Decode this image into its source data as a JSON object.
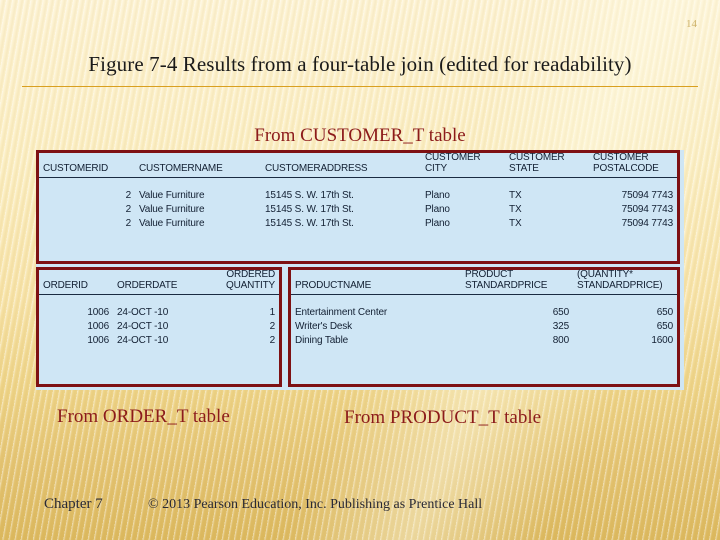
{
  "slide": {
    "title": "Figure 7-4 Results from a four-table join (edited for readability)",
    "accent_rule_color": "#d9a020",
    "caption_color": "#8c1b1b",
    "table_fill_color": "#cfe6f5",
    "table_border_color": "#7e1113",
    "background_top_color": "#fdf3d4",
    "background_bottom_color": "#dcb95f"
  },
  "captions": {
    "customer": "From CUSTOMER_T table",
    "order": "From ORDER_T table",
    "product": "From PRODUCT_T table"
  },
  "customer_table": {
    "headers": [
      {
        "line1": "",
        "line2": "CUSTOMERID"
      },
      {
        "line1": "",
        "line2": "CUSTOMERNAME"
      },
      {
        "line1": "",
        "line2": "CUSTOMERADDRESS"
      },
      {
        "line1": "CUSTOMER",
        "line2": "CITY"
      },
      {
        "line1": "CUSTOMER",
        "line2": "STATE"
      },
      {
        "line1": "CUSTOMER",
        "line2": "POSTALCODE"
      }
    ],
    "rows": [
      [
        "2",
        "Value Furniture",
        "15145 S. W. 17th St.",
        "Plano",
        "TX",
        "75094 7743"
      ],
      [
        "2",
        "Value Furniture",
        "15145 S. W. 17th St.",
        "Plano",
        "TX",
        "75094 7743"
      ],
      [
        "2",
        "Value Furniture",
        "15145 S. W. 17th St.",
        "Plano",
        "TX",
        "75094 7743"
      ]
    ]
  },
  "order_table": {
    "headers": [
      {
        "line1": "",
        "line2": "ORDERID"
      },
      {
        "line1": "",
        "line2": "ORDERDATE"
      },
      {
        "line1": "ORDERED",
        "line2": "QUANTITY"
      }
    ],
    "rows": [
      [
        "1006",
        "24-OCT -10",
        "1"
      ],
      [
        "1006",
        "24-OCT -10",
        "2"
      ],
      [
        "1006",
        "24-OCT -10",
        "2"
      ]
    ]
  },
  "product_table": {
    "headers": [
      {
        "line1": "",
        "line2": "PRODUCTNAME"
      },
      {
        "line1": "PRODUCT",
        "line2": "STANDARDPRICE"
      },
      {
        "line1": "(QUANTITY*",
        "line2": "STANDARDPRICE)"
      }
    ],
    "rows": [
      [
        "Entertainment Center",
        "650",
        "650"
      ],
      [
        "Writer's Desk",
        "325",
        "650"
      ],
      [
        "Dining Table",
        "800",
        "1600"
      ]
    ]
  },
  "footer": {
    "chapter": "Chapter 7",
    "copyright": "© 2013 Pearson Education, Inc.  Publishing as Prentice Hall",
    "page_number": "14"
  }
}
